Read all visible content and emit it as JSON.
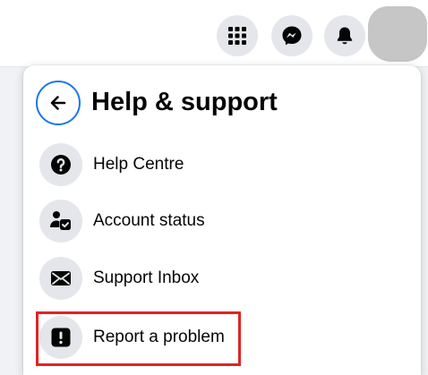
{
  "header": {
    "menu_icon": "grid-menu-icon",
    "messenger_icon": "messenger-icon",
    "notifications_icon": "bell-icon"
  },
  "panel": {
    "title": "Help & support",
    "back_icon": "arrow-left-icon",
    "items": [
      {
        "label": "Help Centre",
        "icon": "question-circle-icon"
      },
      {
        "label": "Account status",
        "icon": "account-status-icon"
      },
      {
        "label": "Support Inbox",
        "icon": "envelope-icon"
      },
      {
        "label": "Report a problem",
        "icon": "exclamation-square-icon"
      }
    ]
  },
  "colors": {
    "accent": "#1877f2",
    "icon_bg": "#e4e6eb",
    "highlight": "#e02424",
    "text": "#050505"
  }
}
